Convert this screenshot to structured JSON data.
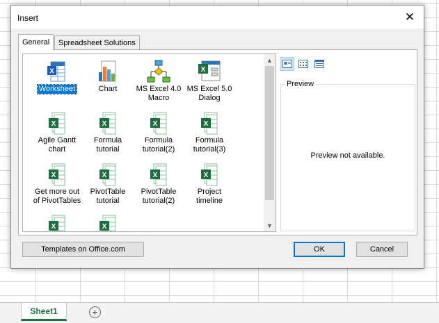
{
  "dialog": {
    "title": "Insert",
    "close_symbol": "✕"
  },
  "tabs": [
    {
      "label": "General",
      "active": true
    },
    {
      "label": "Spreadsheet Solutions",
      "active": false
    }
  ],
  "templates": [
    {
      "label": "Worksheet",
      "icon": "worksheet-icon",
      "selected": true
    },
    {
      "label": "Chart",
      "icon": "chart-icon",
      "selected": false
    },
    {
      "label": "MS Excel 4.0\nMacro",
      "icon": "macro-flowchart-icon",
      "selected": false
    },
    {
      "label": "MS Excel 5.0\nDialog",
      "icon": "dialog-form-icon",
      "selected": false
    },
    {
      "label": "Agile Gantt\nchart",
      "icon": "excel-template-icon",
      "selected": false
    },
    {
      "label": "Formula\ntutorial",
      "icon": "excel-template-icon",
      "selected": false
    },
    {
      "label": "Formula\ntutorial(2)",
      "icon": "excel-template-icon",
      "selected": false
    },
    {
      "label": "Formula\ntutorial(3)",
      "icon": "excel-template-icon",
      "selected": false
    },
    {
      "label": "Get more out\nof PivotTables",
      "icon": "excel-template-icon",
      "selected": false
    },
    {
      "label": "PivotTable\ntutorial",
      "icon": "excel-template-icon",
      "selected": false
    },
    {
      "label": "PivotTable\ntutorial(2)",
      "icon": "excel-template-icon",
      "selected": false
    },
    {
      "label": "Project\ntimeline",
      "icon": "excel-template-icon",
      "selected": false
    },
    {
      "label": "",
      "icon": "excel-template-icon",
      "selected": false
    },
    {
      "label": "",
      "icon": "excel-template-icon",
      "selected": false
    }
  ],
  "views": [
    {
      "name": "large-icons-view-icon",
      "active": true
    },
    {
      "name": "list-view-icon",
      "active": false
    },
    {
      "name": "details-view-icon",
      "active": false
    }
  ],
  "preview": {
    "legend": "Preview",
    "message": "Preview not available."
  },
  "buttons": {
    "templates_online": "Templates on Office.com",
    "ok": "OK",
    "cancel": "Cancel"
  },
  "sheet_tabs": {
    "active": "Sheet1",
    "add_symbol": "+"
  },
  "colors": {
    "excel_green": "#217346",
    "selection_blue": "#0078d7"
  }
}
